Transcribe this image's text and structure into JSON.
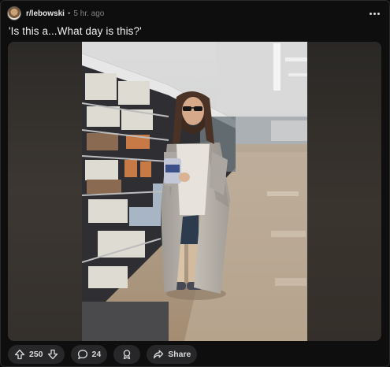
{
  "header": {
    "subreddit": "r/lebowski",
    "separator": "•",
    "timestamp": "5 hr. ago"
  },
  "post": {
    "title": "'Is this a...What day is this?'"
  },
  "actions": {
    "score": "250",
    "comments": "24",
    "share_label": "Share"
  },
  "icons": [
    "more-options-icon",
    "upvote-icon",
    "downvote-icon",
    "comment-icon",
    "award-icon",
    "share-icon"
  ],
  "colors": {
    "background": "#0e0e0e",
    "pill": "#272729",
    "text": "#d7dadc",
    "muted": "#818384"
  }
}
